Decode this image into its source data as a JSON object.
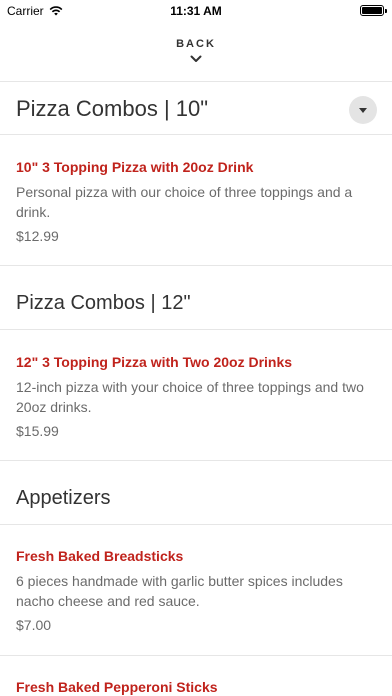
{
  "status_bar": {
    "carrier": "Carrier",
    "time": "11:31 AM",
    "wifi_icon": "wifi-icon",
    "battery_icon": "battery-icon"
  },
  "nav": {
    "back_label": "BACK",
    "back_icon": "chevron-down-icon"
  },
  "sections": [
    {
      "title": "Pizza Combos | 10\"",
      "toggle_icon": "caret-down-icon",
      "items": [
        {
          "name": "10\" 3 Topping Pizza with 20oz Drink",
          "description": "Personal pizza with our choice of three toppings and a drink.",
          "price": "$12.99"
        }
      ]
    },
    {
      "title": "Pizza Combos | 12\"",
      "items": [
        {
          "name": "12\" 3 Topping Pizza with Two 20oz Drinks",
          "description": "12-inch pizza with your choice of three toppings and two 20oz drinks.",
          "price": "$15.99"
        }
      ]
    },
    {
      "title": "Appetizers",
      "items": [
        {
          "name": "Fresh Baked Breadsticks",
          "description": "6 pieces handmade with garlic butter spices includes nacho cheese and red sauce.",
          "price": "$7.00"
        },
        {
          "name": "Fresh Baked Pepperoni Sticks"
        }
      ]
    }
  ],
  "colors": {
    "item_name": "#c0231c",
    "muted_text": "#6b6b6b",
    "divider": "#e6e6e6"
  }
}
